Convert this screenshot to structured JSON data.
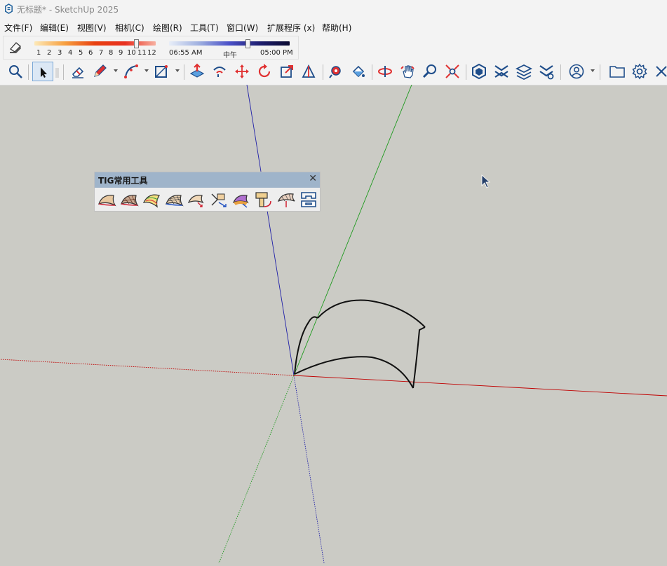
{
  "window": {
    "title": "无标题* - SketchUp 2025"
  },
  "menu": {
    "items": [
      "文件(F)",
      "编辑(E)",
      "视图(V)",
      "相机(C)",
      "绘图(R)",
      "工具(T)",
      "窗口(W)",
      "扩展程序 (x)",
      "帮助(H)"
    ]
  },
  "shadows": {
    "months": [
      "1",
      "2",
      "3",
      "4",
      "5",
      "6",
      "7",
      "8",
      "9",
      "10",
      "11",
      "12"
    ],
    "month_value": 10,
    "time_labels": {
      "start": "06:55 AM",
      "noon": "中午",
      "end": "05:00 PM"
    },
    "time_fraction": 0.64
  },
  "tig_panel": {
    "title": "TIG常用工具",
    "close": "✕"
  },
  "colors": {
    "background": "#cbcbc5",
    "red_axis": "#c00000",
    "green_axis": "#1f9a1f",
    "blue_axis": "#1f1fa8",
    "panel_header": "#9fb4ca"
  }
}
